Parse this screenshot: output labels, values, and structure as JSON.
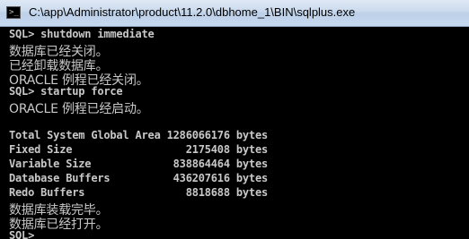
{
  "window": {
    "title": "C:\\app\\Administrator\\product\\11.2.0\\dbhome_1\\BIN\\sqlplus.exe"
  },
  "console": {
    "lines": [
      "SQL> shutdown immediate",
      "数据库已经关闭。",
      "已经卸载数据库。",
      "ORACLE 例程已经关闭。",
      "SQL> startup force",
      "ORACLE 例程已经启动。",
      "",
      "Total System Global Area 1286066176 bytes",
      "Fixed Size                  2175408 bytes",
      "Variable Size             838864464 bytes",
      "Database Buffers          436207616 bytes",
      "Redo Buffers                8818688 bytes",
      "数据库装载完毕。",
      "数据库已经打开。",
      "SQL>"
    ]
  }
}
